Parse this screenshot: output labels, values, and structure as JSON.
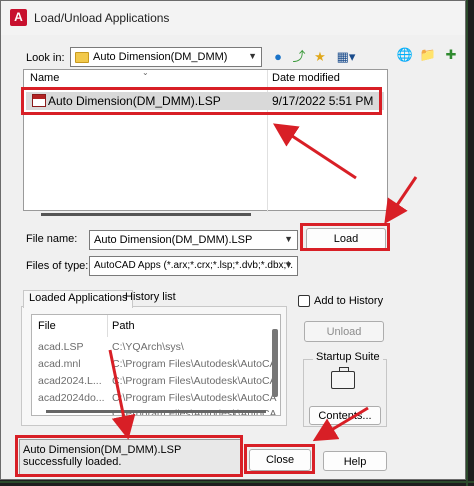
{
  "window": {
    "title": "Load/Unload Applications"
  },
  "look_in": {
    "label": "Look in:",
    "value": "Auto Dimension(DM_DMM)"
  },
  "toolbar": {
    "icons": [
      "globe-back-icon",
      "up-folder-icon",
      "new-folder-icon",
      "views-icon",
      "search-web-icon",
      "favorites-icon",
      "add-favorite-icon"
    ]
  },
  "file_list": {
    "columns": [
      "Name",
      "Date modified"
    ],
    "rows": [
      {
        "name": "Auto Dimension(DM_DMM).LSP",
        "date": "9/17/2022 5:51 PM"
      }
    ]
  },
  "file_name": {
    "label": "File name:",
    "value": "Auto Dimension(DM_DMM).LSP"
  },
  "files_of_type": {
    "label": "Files of type:",
    "value": "AutoCAD Apps (*.arx;*.crx;*.lsp;*.dvb;*.dbx;*."
  },
  "buttons": {
    "load": "Load",
    "unload": "Unload",
    "contents": "Contents...",
    "close": "Close",
    "help": "Help"
  },
  "tabs": [
    "Loaded Applications",
    "History list"
  ],
  "add_to_history": "Add to History",
  "loaded_apps": {
    "columns": [
      "File",
      "Path"
    ],
    "rows": [
      {
        "file": "acad.LSP",
        "path": "C:\\YQArch\\sys\\"
      },
      {
        "file": "acad.mnl",
        "path": "C:\\Program Files\\Autodesk\\AutoCA"
      },
      {
        "file": "acad2024.L...",
        "path": "C:\\Program Files\\Autodesk\\AutoCA"
      },
      {
        "file": "acad2024do...",
        "path": "C:\\Program Files\\Autodesk\\AutoCA"
      },
      {
        "file": "...",
        "path": "C:\\Program Files\\Autodesk\\AutoCA"
      }
    ]
  },
  "startup_suite": {
    "title": "Startup Suite"
  },
  "status": {
    "message": "Auto Dimension(DM_DMM).LSP successfully loaded."
  },
  "colors": {
    "highlight": "#d81f26",
    "accent_icon": "#c8102e"
  }
}
